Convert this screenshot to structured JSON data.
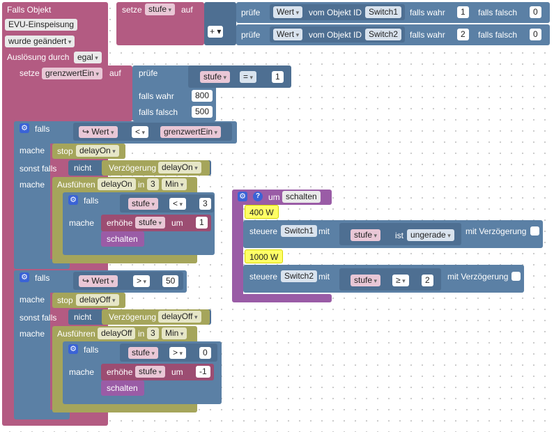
{
  "trigger": {
    "title": "Falls Objekt",
    "object": "EVU-Einspeisung",
    "event": "wurde geändert",
    "trigger_label": "Auslösung durch",
    "trigger_value": "egal"
  },
  "top_set": {
    "setze": "setze",
    "var": "stufe",
    "auf": "auf",
    "plus": "+ ▾",
    "check1": {
      "pruefe": "prüfe",
      "wert": "Wert",
      "vom": "vom Objekt ID",
      "obj": "Switch1",
      "wahr": "falls wahr",
      "wahr_val": "1",
      "falsch": "falls falsch",
      "falsch_val": "0"
    },
    "check2": {
      "pruefe": "prüfe",
      "wert": "Wert",
      "vom": "vom Objekt ID",
      "obj": "Switch2",
      "wahr": "falls wahr",
      "wahr_val": "2",
      "falsch": "falls falsch",
      "falsch_val": "0"
    }
  },
  "set_grenz": {
    "setze": "setze",
    "var": "grenzwertEin",
    "auf": "auf",
    "pruefe": "prüfe",
    "cond_var": "stufe",
    "cond_op": "=",
    "cond_val": "1",
    "wahr": "falls wahr",
    "wahr_val": "800",
    "falsch": "falls falsch",
    "falsch_val": "500"
  },
  "if1": {
    "falls": "falls",
    "arrow_wert": "↪ Wert",
    "op": "<",
    "rhs": "grenzwertEin",
    "mache": "mache",
    "stop": "stop",
    "stop_var": "delayOn",
    "sonst": "sonst falls",
    "nicht": "nicht",
    "verz": "Verzögerung",
    "verz_var": "delayOn",
    "mache2": "mache",
    "ausf": "Ausführen",
    "ausf_var": "delayOn",
    "in": "in",
    "in_val": "3",
    "unit": "Min",
    "inner": {
      "falls": "falls",
      "var": "stufe",
      "op": "<",
      "val": "3",
      "mache": "mache",
      "erhoehe": "erhöhe",
      "erh_var": "stufe",
      "um": "um",
      "um_val": "1",
      "call": "schalten"
    }
  },
  "if2": {
    "falls": "falls",
    "arrow_wert": "↪ Wert",
    "op": ">",
    "rhs": "50",
    "mache": "mache",
    "stop": "stop",
    "stop_var": "delayOff",
    "sonst": "sonst falls",
    "nicht": "nicht",
    "verz": "Verzögerung",
    "verz_var": "delayOff",
    "mache2": "mache",
    "ausf": "Ausführen",
    "ausf_var": "delayOff",
    "in": "in",
    "in_val": "3",
    "unit": "Min",
    "inner": {
      "falls": "falls",
      "var": "stufe",
      "op": ">",
      "val": "0",
      "mache": "mache",
      "erhoehe": "erhöhe",
      "erh_var": "stufe",
      "um": "um",
      "um_val": "-1",
      "call": "schalten"
    }
  },
  "func": {
    "um": "um",
    "name": "schalten",
    "c1": "400 W",
    "st1": {
      "steuere": "steuere",
      "obj": "Switch1",
      "mit": "mit",
      "var": "stufe",
      "ist": "ist",
      "cond": "ungerade",
      "verz": "mit Verzögerung"
    },
    "c2": "1000 W",
    "st2": {
      "steuere": "steuere",
      "obj": "Switch2",
      "mit": "mit",
      "var": "stufe",
      "op": "≥",
      "val": "2",
      "verz": "mit Verzögerung"
    }
  },
  "colors": {
    "trigger": "#b35b82",
    "logic": "#5b80a5",
    "timer": "#a5a55b",
    "function": "#9a5ca6",
    "comment": "#ffff66"
  }
}
